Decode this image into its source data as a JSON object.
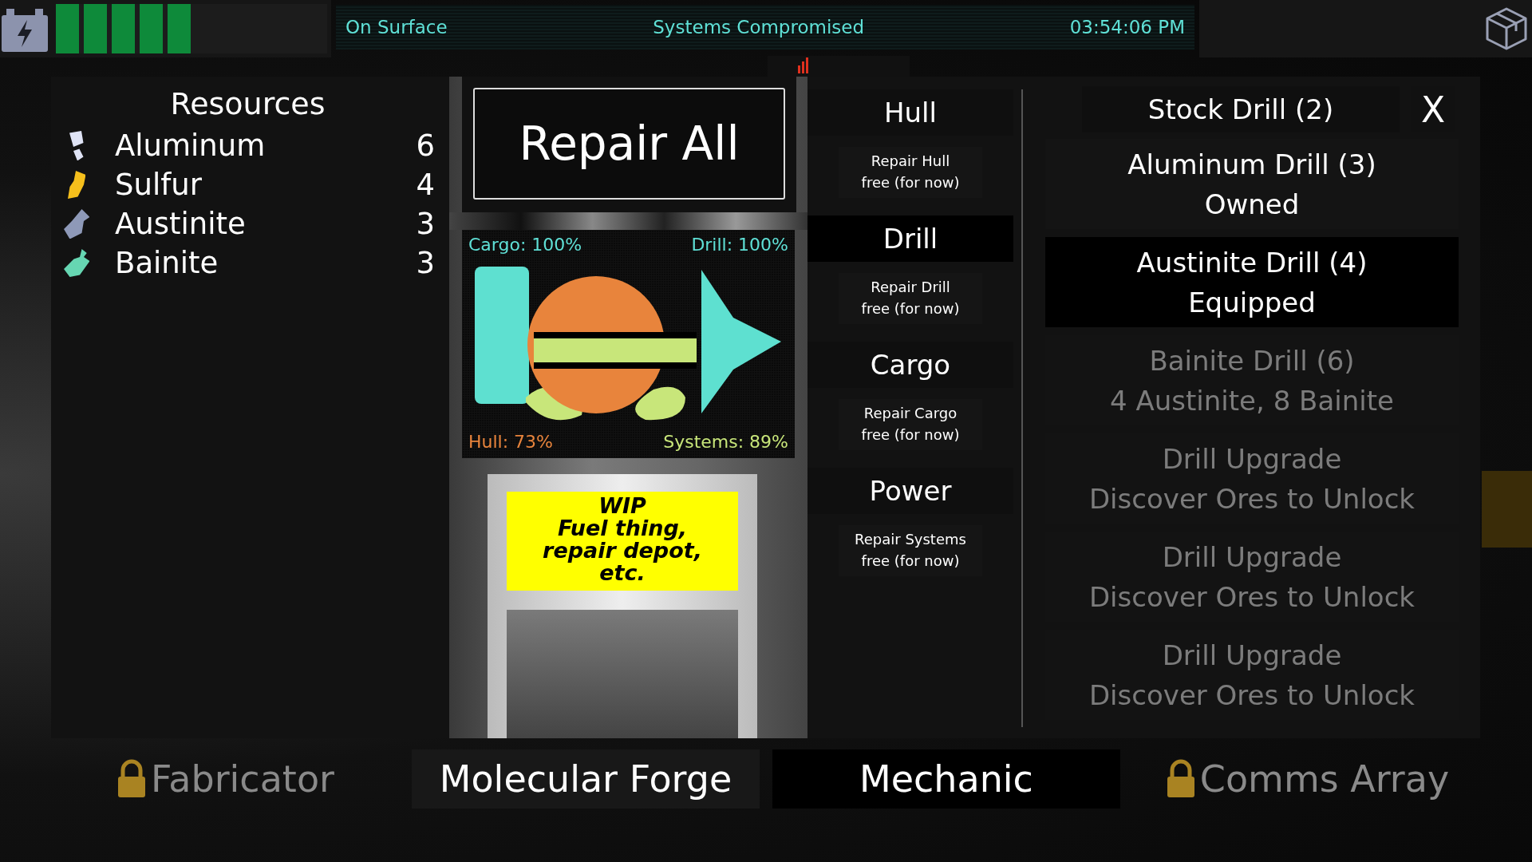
{
  "top_bar": {
    "power": {
      "level": 0.5
    },
    "location": "On Surface",
    "status": "Systems Compromised",
    "time": "03:54:06 PM"
  },
  "resources": {
    "title": "Resources",
    "items": [
      {
        "name": "Aluminum",
        "count": "6",
        "color": "#dfe3f5"
      },
      {
        "name": "Sulfur",
        "count": "4",
        "color": "#f5bf1c"
      },
      {
        "name": "Austinite",
        "count": "3",
        "color": "#8e99b8"
      },
      {
        "name": "Bainite",
        "count": "3",
        "color": "#66d6b2"
      }
    ]
  },
  "repair_all": "Repair All",
  "monitor": {
    "cargo": "Cargo: 100%",
    "drill": "Drill: 100%",
    "hull": "Hull: 73%",
    "systems": "Systems: 89%"
  },
  "wip_sign": [
    "WIP",
    "Fuel thing,",
    "repair depot,",
    "etc."
  ],
  "repair_sections": [
    {
      "title": "Hull",
      "selected": false,
      "action": "Repair Hull",
      "cost": "free (for now)"
    },
    {
      "title": "Drill",
      "selected": true,
      "action": "Repair Drill",
      "cost": "free (for now)"
    },
    {
      "title": "Cargo",
      "selected": false,
      "action": "Repair Cargo",
      "cost": "free (for now)"
    },
    {
      "title": "Power",
      "selected": false,
      "action": "Repair Systems",
      "cost": "free (for now)"
    }
  ],
  "drills": {
    "header": "Stock Drill (2)",
    "close": "X",
    "items": [
      {
        "name": "Aluminum Drill (3)",
        "detail": "Owned",
        "selected": false,
        "disabled": false
      },
      {
        "name": "Austinite Drill (4)",
        "detail": "Equipped",
        "selected": true,
        "disabled": false
      },
      {
        "name": "Bainite Drill (6)",
        "detail": "4 Austinite, 8 Bainite",
        "selected": false,
        "disabled": true
      },
      {
        "name": "Drill Upgrade",
        "detail": "Discover Ores to Unlock",
        "selected": false,
        "disabled": true
      },
      {
        "name": "Drill Upgrade",
        "detail": "Discover Ores to Unlock",
        "selected": false,
        "disabled": true
      },
      {
        "name": "Drill Upgrade",
        "detail": "Discover Ores to Unlock",
        "selected": false,
        "disabled": true
      }
    ]
  },
  "tabs": [
    {
      "label": "Fabricator",
      "locked": true,
      "selected": false
    },
    {
      "label": "Molecular Forge",
      "locked": false,
      "selected": false
    },
    {
      "label": "Mechanic",
      "locked": false,
      "selected": true
    },
    {
      "label": "Comms Array",
      "locked": true,
      "selected": false
    }
  ]
}
